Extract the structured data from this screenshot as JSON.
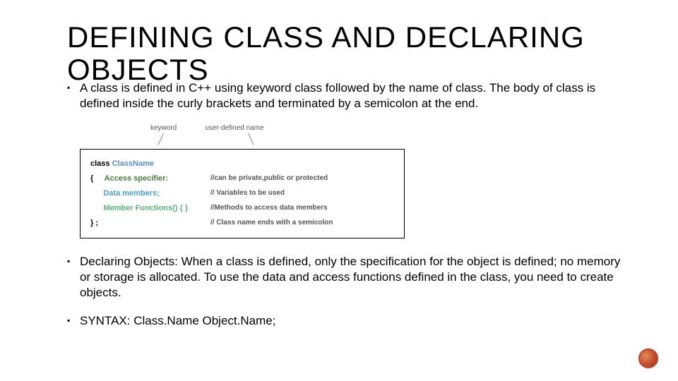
{
  "title": "DEFINING CLASS AND DECLARING OBJECTS",
  "bullet1": "A class is defined in C++ using keyword class followed by the name of class. The body of class is defined inside the curly brackets and terminated by a semicolon at the end.",
  "bullet2": "Declaring Objects: When a class is defined, only the specification for the object is defined; no memory or storage is allocated. To use the data and access functions defined in the class, you need to create objects.",
  "bullet3": "SYNTAX: Class.Name Object.Name;",
  "diagram": {
    "label_keyword": "keyword",
    "label_username": "user-defined name",
    "line1_kw": "class",
    "line1_cls": "ClassName",
    "line2_left": "{",
    "line2_spec": "Access specifier:",
    "line2_cmt": "//can be private,public or protected",
    "line3_dm": "Data members;",
    "line3_cmt": "// Variables to be used",
    "line4_mf": "Member Functions() { }",
    "line4_cmt": "//Methods to access data members",
    "line5_left": "} ;",
    "line5_cmt": "// Class name ends with a semicolon"
  }
}
